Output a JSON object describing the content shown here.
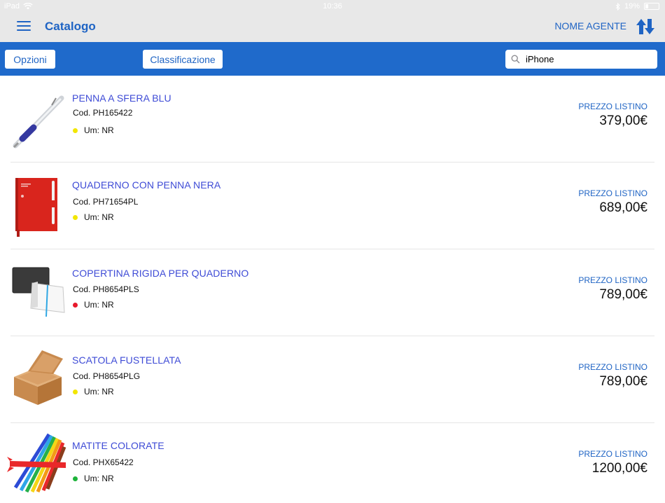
{
  "status": {
    "device": "iPad",
    "time": "10:36",
    "battery": "19%"
  },
  "header": {
    "title": "Catalogo",
    "agent": "NOME AGENTE"
  },
  "toolbar": {
    "options_label": "Opzioni",
    "classification_label": "Classificazione",
    "search_value": "iPhone"
  },
  "products": [
    {
      "name": "PENNA A SFERA BLU",
      "code": "Cod. PH165422",
      "um": "Um: NR",
      "dot_color": "#f2e600",
      "price_label": "PREZZO LISTINO",
      "price": "379,00€"
    },
    {
      "name": "QUADERNO CON PENNA NERA",
      "code": "Cod. PH71654PL",
      "um": "Um: NR",
      "dot_color": "#f2e600",
      "price_label": "PREZZO LISTINO",
      "price": "689,00€"
    },
    {
      "name": "COPERTINA RIGIDA PER QUADERNO",
      "code": "Cod. PH8654PLS",
      "um": "Um: NR",
      "dot_color": "#e8192c",
      "price_label": "PREZZO LISTINO",
      "price": "789,00€"
    },
    {
      "name": "SCATOLA FUSTELLATA",
      "code": "Cod. PH8654PLG",
      "um": "Um: NR",
      "dot_color": "#f2e600",
      "price_label": "PREZZO LISTINO",
      "price": "789,00€"
    },
    {
      "name": "MATITE COLORATE",
      "code": "Cod. PHX65422",
      "um": "Um: NR",
      "dot_color": "#1db33a",
      "price_label": "PREZZO LISTINO",
      "price": "1200,00€"
    }
  ],
  "colors": {
    "accent": "#1f6acb",
    "title_blue": "#1f64c4",
    "product_name": "#3e4bd6"
  }
}
